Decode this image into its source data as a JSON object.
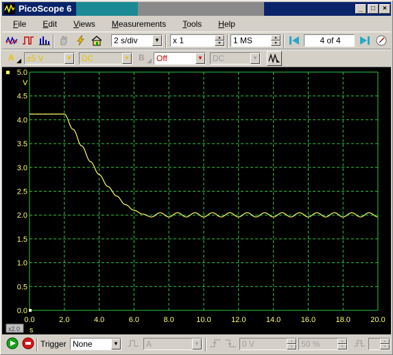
{
  "window": {
    "title": "PicoScope 6",
    "minimize_label": "_",
    "restore_label": "□",
    "close_label": "×"
  },
  "menu": {
    "items": [
      {
        "first": "F",
        "rest": "ile"
      },
      {
        "first": "E",
        "rest": "dit"
      },
      {
        "first": "V",
        "rest": "iews"
      },
      {
        "first": "M",
        "rest": "easurements"
      },
      {
        "first": "T",
        "rest": "ools"
      },
      {
        "first": "H",
        "rest": "elp"
      }
    ]
  },
  "toolbar1": {
    "timebase": "2 s/div",
    "zoom": "x 1",
    "samples": "1 MS",
    "buffer": "4 of 4"
  },
  "toolbar2": {
    "channel_a_label": "A",
    "channel_a_range": "±5 V",
    "channel_a_coupling": "DC",
    "channel_b_label": "B",
    "channel_b_range": "Off",
    "channel_b_coupling": "DC"
  },
  "scope": {
    "y_unit": "V",
    "x_unit": "s",
    "x_zoom_badge": "x2.0",
    "grid_color": "#2ecc40",
    "trace_color": "#ffff66",
    "axis_label_color": "#ffff66"
  },
  "status": {
    "trigger_label": "Trigger",
    "trigger_mode": "None",
    "trigger_channel": "A",
    "trigger_level": "0 V",
    "pretrigger": "50 %"
  },
  "chart_data": {
    "type": "line",
    "title": "",
    "xlabel": "s",
    "ylabel": "V",
    "xlim": [
      0,
      20
    ],
    "ylim": [
      0,
      5
    ],
    "x_ticks": [
      "0.0",
      "2.0",
      "4.0",
      "6.0",
      "8.0",
      "10.0",
      "12.0",
      "14.0",
      "16.0",
      "18.0",
      "20.0"
    ],
    "y_ticks": [
      "0.0",
      "0.5",
      "1.0",
      "1.5",
      "2.0",
      "2.5",
      "3.0",
      "3.5",
      "4.0",
      "4.5",
      "5.0"
    ],
    "grid": true,
    "series": [
      {
        "x": [
          0,
          2.0,
          2.5,
          3.0,
          3.5,
          4.0,
          4.5,
          5.0,
          5.5,
          6.0,
          6.5,
          7.0,
          7.5,
          8.0,
          8.5,
          9.0,
          9.5,
          10.0,
          10.5,
          11.0,
          11.5,
          12.0,
          12.5,
          13.0,
          13.5,
          14.0,
          14.5,
          15.0,
          15.5,
          16.0,
          16.5,
          17.0,
          17.5,
          18.0,
          18.5,
          19.0,
          19.5,
          20.0
        ],
        "values": [
          4.12,
          4.12,
          3.8,
          3.45,
          3.12,
          2.85,
          2.6,
          2.4,
          2.22,
          2.1,
          2.02,
          1.96,
          2.05,
          1.96,
          2.05,
          1.96,
          2.05,
          1.96,
          2.05,
          1.96,
          2.05,
          1.96,
          2.05,
          1.96,
          2.05,
          1.96,
          2.05,
          1.96,
          2.05,
          1.96,
          2.05,
          1.96,
          2.05,
          1.96,
          2.05,
          1.96,
          2.05,
          1.96
        ]
      }
    ]
  }
}
